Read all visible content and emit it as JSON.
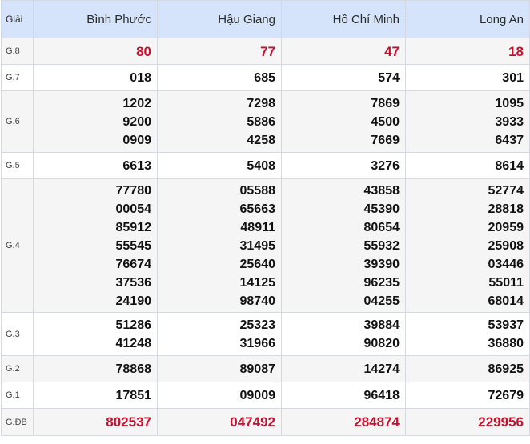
{
  "header": {
    "giai": "Giải",
    "provinces": [
      "Bình Phước",
      "Hậu Giang",
      "Hồ Chí Minh",
      "Long An"
    ]
  },
  "rows": [
    {
      "label": "G.8",
      "values": [
        [
          "80"
        ],
        [
          "77"
        ],
        [
          "47"
        ],
        [
          "18"
        ]
      ]
    },
    {
      "label": "G.7",
      "values": [
        [
          "018"
        ],
        [
          "685"
        ],
        [
          "574"
        ],
        [
          "301"
        ]
      ]
    },
    {
      "label": "G.6",
      "values": [
        [
          "1202",
          "9200",
          "0909"
        ],
        [
          "7298",
          "5886",
          "4258"
        ],
        [
          "7869",
          "4500",
          "7669"
        ],
        [
          "1095",
          "3933",
          "6437"
        ]
      ]
    },
    {
      "label": "G.5",
      "values": [
        [
          "6613"
        ],
        [
          "5408"
        ],
        [
          "3276"
        ],
        [
          "8614"
        ]
      ]
    },
    {
      "label": "G.4",
      "values": [
        [
          "77780",
          "00054",
          "85912",
          "55545",
          "76674",
          "37536",
          "24190"
        ],
        [
          "05588",
          "65663",
          "48911",
          "31495",
          "25640",
          "14125",
          "98740"
        ],
        [
          "43858",
          "45390",
          "80654",
          "55932",
          "39390",
          "96235",
          "04255"
        ],
        [
          "52774",
          "28818",
          "20959",
          "25908",
          "03446",
          "55011",
          "68014"
        ]
      ]
    },
    {
      "label": "G.3",
      "values": [
        [
          "51286",
          "41248"
        ],
        [
          "25323",
          "31966"
        ],
        [
          "39884",
          "90820"
        ],
        [
          "53937",
          "36880"
        ]
      ]
    },
    {
      "label": "G.2",
      "values": [
        [
          "78868"
        ],
        [
          "89087"
        ],
        [
          "14274"
        ],
        [
          "86925"
        ]
      ]
    },
    {
      "label": "G.1",
      "values": [
        [
          "17851"
        ],
        [
          "09009"
        ],
        [
          "96418"
        ],
        [
          "72679"
        ]
      ]
    },
    {
      "label": "G.ĐB",
      "values": [
        [
          "802537"
        ],
        [
          "047492"
        ],
        [
          "284874"
        ],
        [
          "229956"
        ]
      ]
    }
  ]
}
